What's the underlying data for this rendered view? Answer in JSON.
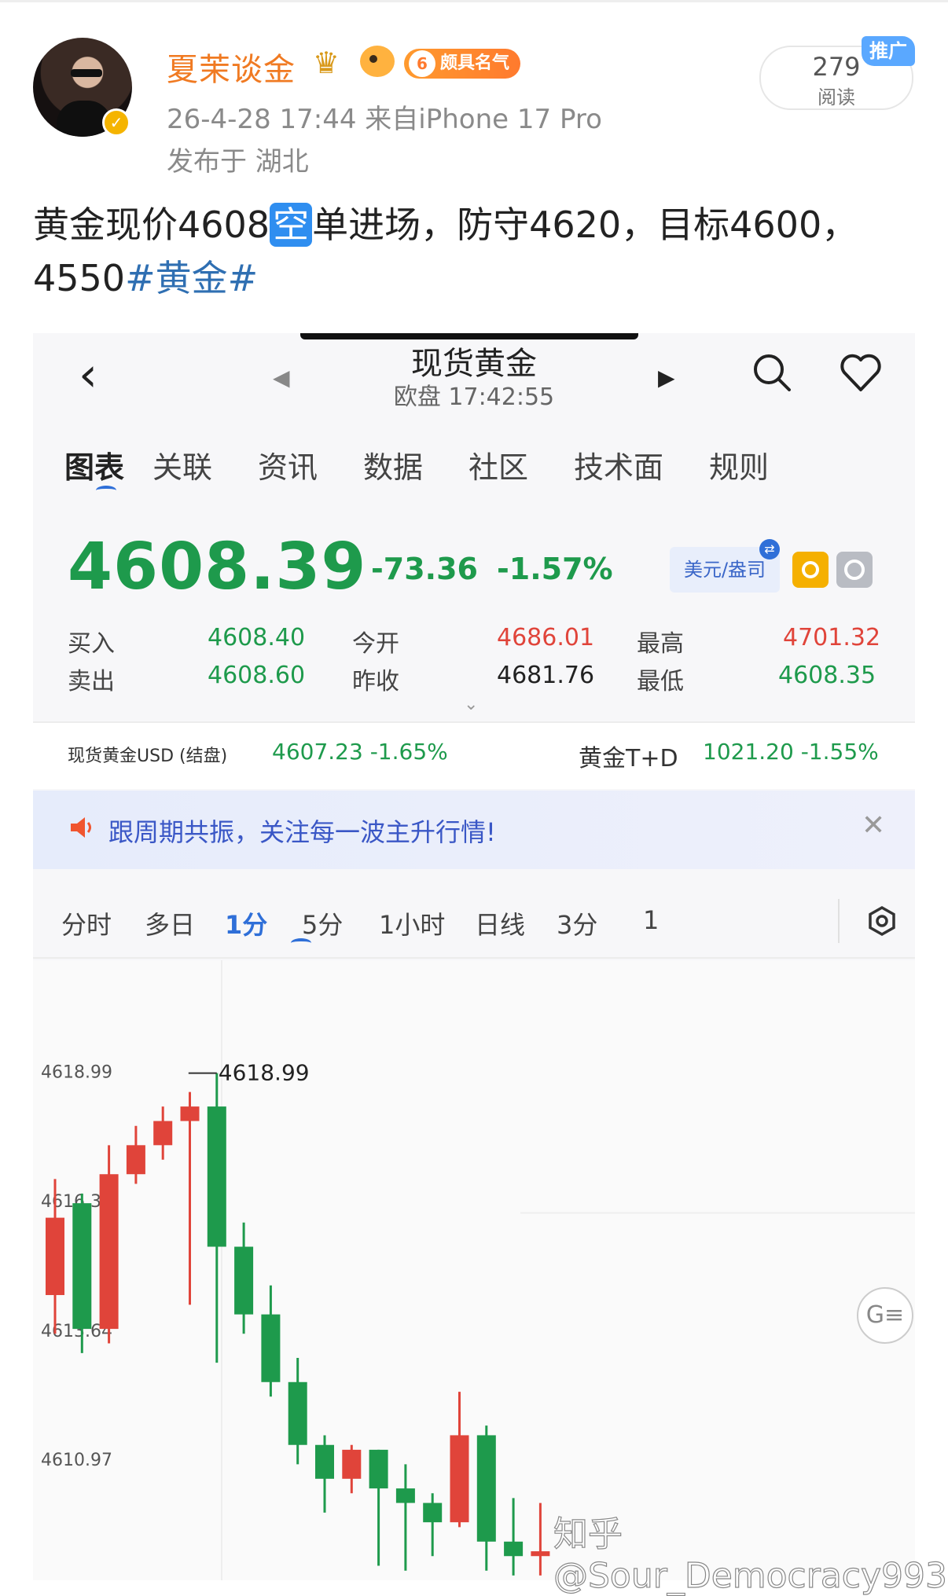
{
  "post": {
    "username": "夏茉谈金",
    "fame_level": "6",
    "fame_label": "颇具名气",
    "meta": "26-4-28 17:44  来自iPhone 17 Pro",
    "location": "发布于 湖北",
    "reads_count": "279",
    "reads_label": "阅读",
    "promo_tag": "推广",
    "text_part1": "黄金现价4608",
    "text_highlight": "空",
    "text_part2": "单进场，防守4620，目标4600，4550",
    "hashtag": "#黄金#"
  },
  "app": {
    "nav": {
      "title": "现货黄金",
      "subtitle": "欧盘 17:42:55",
      "back_icon": "chevron-left-icon",
      "prev_icon": "triangle-left-icon",
      "next_icon": "triangle-right-icon",
      "search_icon": "search-icon",
      "favorite_icon": "heart-icon"
    },
    "tabs": [
      "图表",
      "关联",
      "资讯",
      "数据",
      "社区",
      "技术面",
      "规则"
    ],
    "active_tab": "图表",
    "quote": {
      "price": "4608.39",
      "change": "-73.36",
      "change_pct": "-1.57%",
      "unit": "美元/盎司",
      "buy_label": "买入",
      "buy": "4608.40",
      "sell_label": "卖出",
      "sell": "4608.60",
      "open_label": "今开",
      "open": "4686.01",
      "prev_close_label": "昨收",
      "prev_close": "4681.76",
      "high_label": "最高",
      "high": "4701.32",
      "low_label": "最低",
      "low": "4608.35"
    },
    "related": {
      "left_label": "现货黄金USD (结盘)",
      "left_value": "4607.23  -1.65%",
      "right_label": "黄金T+D",
      "right_value": "1021.20  -1.55%"
    },
    "banner": {
      "text": "跟周期共振，关注每一波主升行情!",
      "icon": "speaker-icon",
      "close_icon": "close-icon"
    },
    "periods": [
      "分时",
      "多日",
      "1分",
      "5分",
      "1小时",
      "日线",
      "3分",
      "1"
    ],
    "active_period": "1分",
    "colors": {
      "up": "#e0443a",
      "down": "#1e9a4c",
      "accent": "#2f6fd8",
      "username": "#f07a22"
    }
  },
  "chart_data": {
    "type": "candlestick",
    "y_tick_labels": [
      "4618.99",
      "4616.32",
      "4613.64",
      "4610.97"
    ],
    "max_annotation": "4618.99",
    "ylim": [
      4608.5,
      4621.0
    ],
    "candles": [
      {
        "open": 4614.4,
        "close": 4616.0,
        "high": 4616.8,
        "low": 4613.6
      },
      {
        "open": 4616.3,
        "close": 4613.7,
        "high": 4616.5,
        "low": 4613.2
      },
      {
        "open": 4613.7,
        "close": 4616.9,
        "high": 4617.5,
        "low": 4613.4
      },
      {
        "open": 4616.9,
        "close": 4617.5,
        "high": 4617.9,
        "low": 4616.7
      },
      {
        "open": 4617.5,
        "close": 4618.0,
        "high": 4618.3,
        "low": 4617.2
      },
      {
        "open": 4618.0,
        "close": 4618.3,
        "high": 4618.6,
        "low": 4614.2
      },
      {
        "open": 4618.3,
        "close": 4615.4,
        "high": 4618.99,
        "low": 4613.0
      },
      {
        "open": 4615.4,
        "close": 4614.0,
        "high": 4615.9,
        "low": 4613.6
      },
      {
        "open": 4614.0,
        "close": 4612.6,
        "high": 4614.6,
        "low": 4612.3
      },
      {
        "open": 4612.6,
        "close": 4611.3,
        "high": 4613.1,
        "low": 4610.9
      },
      {
        "open": 4611.3,
        "close": 4610.6,
        "high": 4611.5,
        "low": 4609.9
      },
      {
        "open": 4610.6,
        "close": 4611.2,
        "high": 4611.3,
        "low": 4610.3
      },
      {
        "open": 4611.2,
        "close": 4610.4,
        "high": 4611.2,
        "low": 4608.8
      },
      {
        "open": 4610.4,
        "close": 4610.1,
        "high": 4610.9,
        "low": 4608.7
      },
      {
        "open": 4610.1,
        "close": 4609.7,
        "high": 4610.3,
        "low": 4609.0
      },
      {
        "open": 4609.7,
        "close": 4611.5,
        "high": 4612.4,
        "low": 4609.6
      },
      {
        "open": 4611.5,
        "close": 4609.3,
        "high": 4611.7,
        "low": 4608.7
      },
      {
        "open": 4609.3,
        "close": 4609.0,
        "high": 4610.2,
        "low": 4608.6
      },
      {
        "open": 4609.0,
        "close": 4609.1,
        "high": 4610.1,
        "low": 4608.6
      }
    ]
  },
  "watermark": "知乎 @Sour_Democracy993"
}
